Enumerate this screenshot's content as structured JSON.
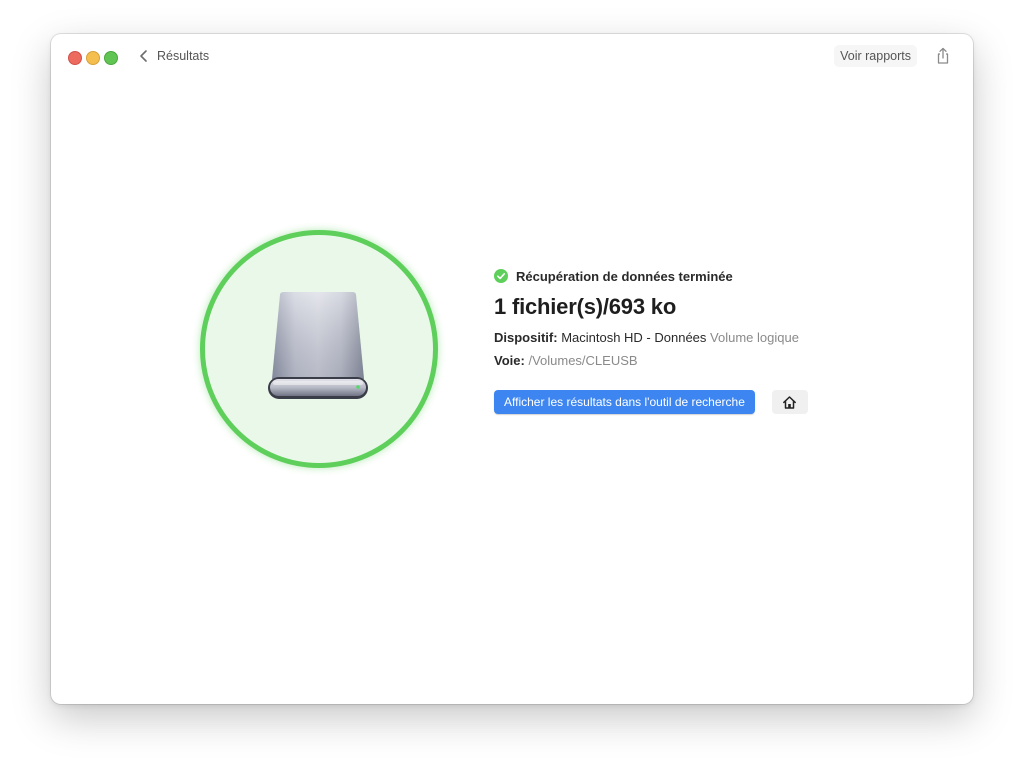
{
  "toolbar": {
    "back_label": "Résultats",
    "reports_label": "Voir rapports"
  },
  "result": {
    "status": "Récupération de données terminée",
    "summary": "1 fichier(s)/693 ko",
    "device_label": "Dispositif:",
    "device_value": "Macintosh HD - Données",
    "device_type": "Volume logique",
    "path_label": "Voie:",
    "path_value": "/Volumes/CLEUSB"
  },
  "actions": {
    "show_results_label": "Afficher les résultats dans l'outil de recherche"
  },
  "icons": {
    "back": "chevron-left-icon",
    "share": "share-icon",
    "status": "check-circle-icon",
    "disk": "external-drive-icon",
    "home": "home-icon"
  },
  "colors": {
    "accent": "#3d86f2",
    "success": "#5dcf5a",
    "circle_fill": "#eaf8e9",
    "traffic_close": "#ed6a5e",
    "traffic_minimize": "#f5bf4f",
    "traffic_zoom": "#61c554"
  }
}
